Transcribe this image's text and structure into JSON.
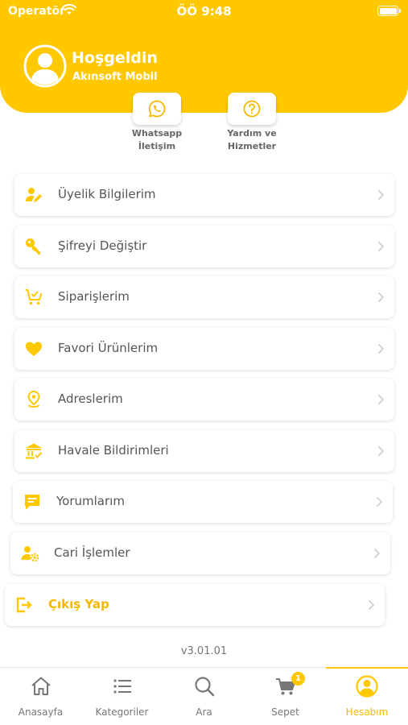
{
  "status_bar": {
    "carrier": "Operatör",
    "time": "ÖÖ 9:48"
  },
  "header": {
    "greeting": "Hoşgeldin",
    "brand": "Akınsoft Mobil"
  },
  "quick_actions": [
    {
      "label": "Whatsapp\nİletişim",
      "icon": "whatsapp-icon"
    },
    {
      "label": "Yardım ve\nHizmetler",
      "icon": "help-icon"
    }
  ],
  "menu": [
    {
      "label": "Üyelik Bilgilerim",
      "icon": "user-edit-icon"
    },
    {
      "label": "Şifreyi Değiştir",
      "icon": "key-icon"
    },
    {
      "label": "Siparişlerim",
      "icon": "cart-check-icon"
    },
    {
      "label": "Favori Ürünlerim",
      "icon": "heart-icon"
    },
    {
      "label": "Adreslerim",
      "icon": "location-pin-icon"
    },
    {
      "label": "Havale Bildirimleri",
      "icon": "bank-icon"
    },
    {
      "label": "Yorumlarım",
      "icon": "comment-icon"
    },
    {
      "label": "Cari İşlemler",
      "icon": "user-settings-icon"
    },
    {
      "label": "Çıkış Yap",
      "icon": "logout-icon"
    }
  ],
  "version": "v3.01.01",
  "tabs": [
    {
      "label": "Anasayfa",
      "icon": "home-icon"
    },
    {
      "label": "Kategoriler",
      "icon": "list-icon"
    },
    {
      "label": "Ara",
      "icon": "search-icon"
    },
    {
      "label": "Sepet",
      "icon": "cart-icon",
      "badge": "1"
    },
    {
      "label": "Hesabım",
      "icon": "profile-icon",
      "active": true
    }
  ],
  "colors": {
    "accent": "#FFC800",
    "accent_text": "#F5B800",
    "text": "#555555"
  }
}
